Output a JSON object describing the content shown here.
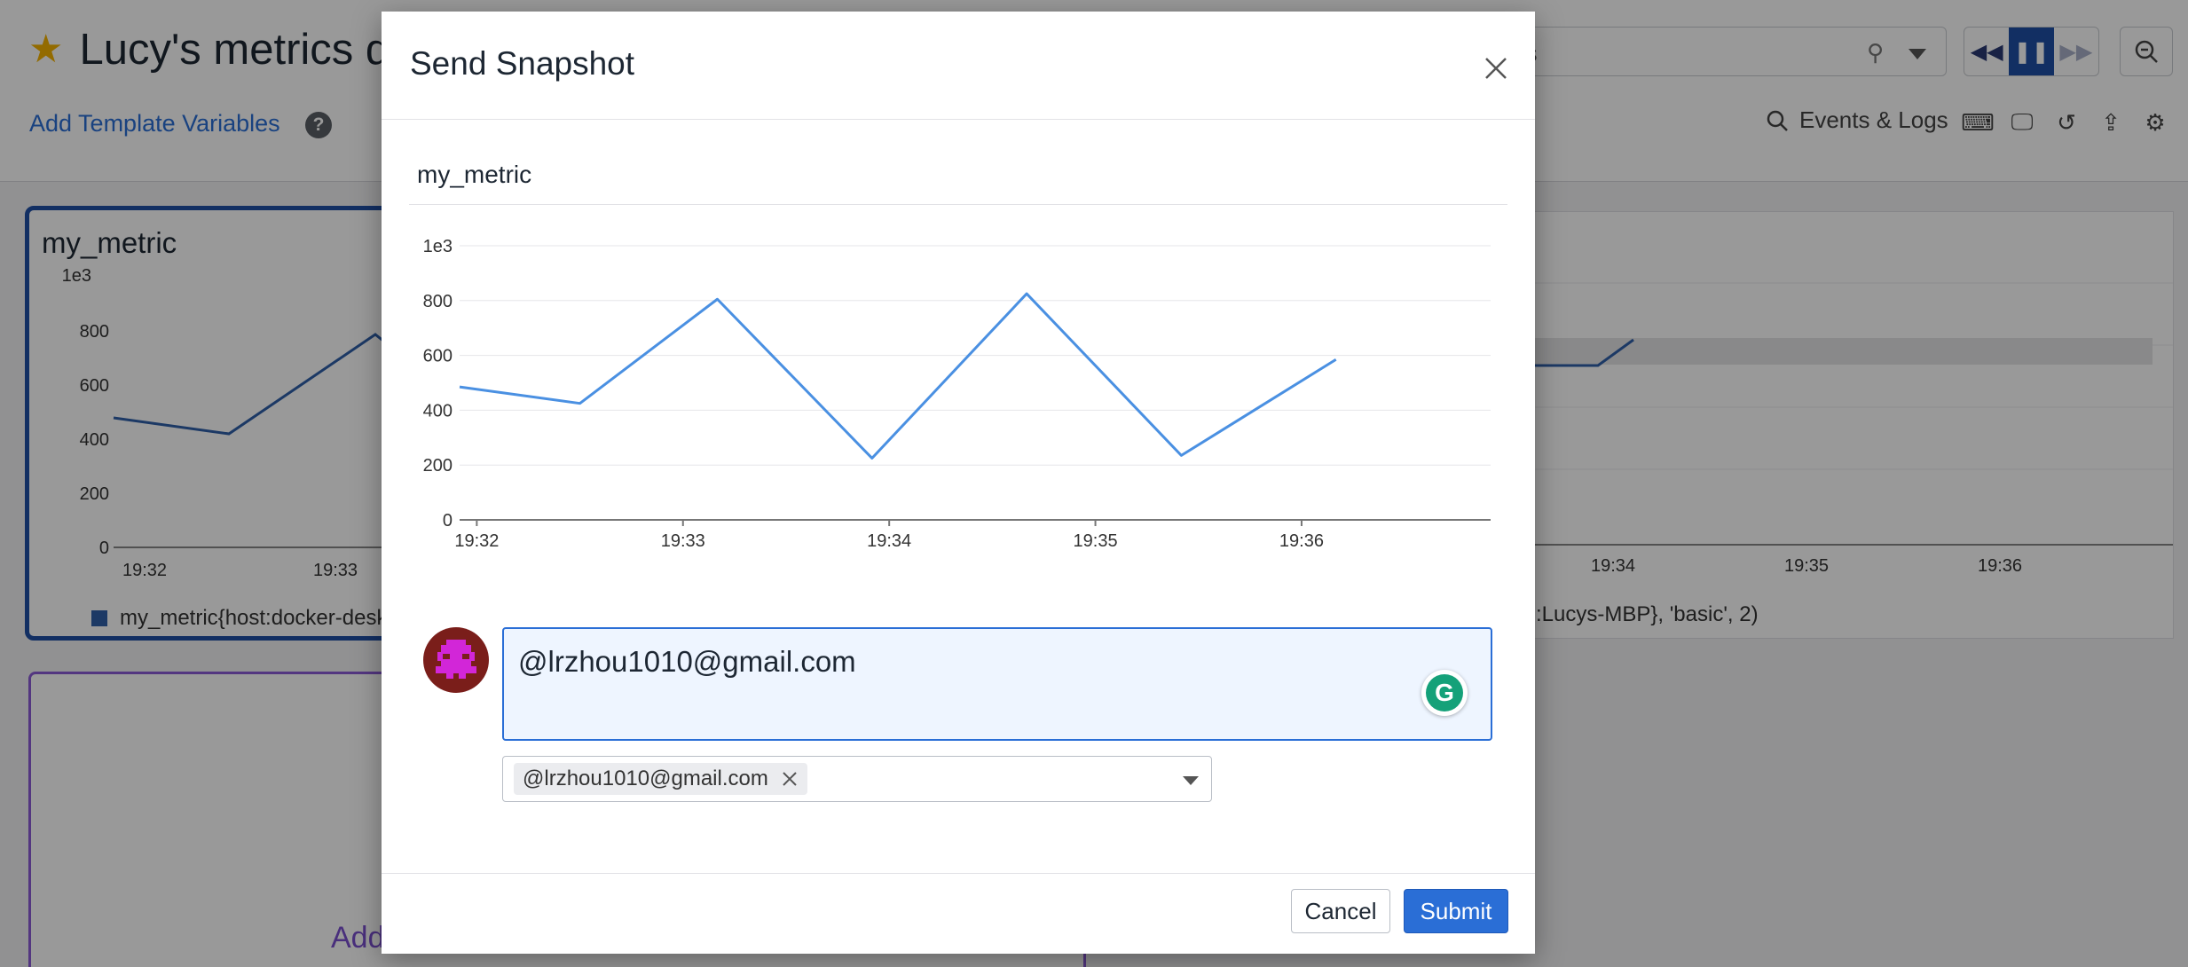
{
  "dashboard": {
    "title": "Lucy's metrics da",
    "add_template_variables": "Add Template Variables",
    "help_glyph": "?",
    "search_visible_text": "s",
    "events_logs": "Events & Logs",
    "left_widget": {
      "title": "my_metric",
      "y_unit": "1e3",
      "y_ticks": [
        "800",
        "600",
        "400",
        "200",
        "0"
      ],
      "x_ticks": [
        "19:32",
        "19:33"
      ],
      "legend": "my_metric{host:docker-desk"
    },
    "right_widget": {
      "x_ticks": [
        "19:34",
        "19:35",
        "19:36"
      ],
      "legend": ":Lucys-MBP}, 'basic', 2)"
    },
    "purple_widget_text": "Add"
  },
  "modal": {
    "title": "Send Snapshot",
    "metric_name": "my_metric",
    "comment_text": "@lrzhou1010@gmail.com",
    "recipient_tag": "@lrzhou1010@gmail.com",
    "cancel_label": "Cancel",
    "submit_label": "Submit"
  },
  "colors": {
    "line": "#4a90e2",
    "primary": "#2a6ed6",
    "active_button": "#1f4fa6",
    "accent_star": "#f5b301"
  },
  "chart_data": {
    "type": "line",
    "title": "my_metric",
    "y_unit_label": "1e3",
    "x_ticks": [
      "19:32",
      "19:33",
      "19:34",
      "19:35",
      "19:36"
    ],
    "y_ticks": [
      "0",
      "200",
      "400",
      "600",
      "800"
    ],
    "ylim": [
      0,
      1000
    ],
    "xlim": [
      "19:31:55",
      "19:36:55"
    ],
    "grid": true,
    "series": [
      {
        "x": [
          "19:31:55",
          "19:32:30",
          "19:33:10",
          "19:33:55",
          "19:34:40",
          "19:35:25",
          "19:36:10"
        ],
        "values": [
          485,
          425,
          805,
          225,
          825,
          235,
          585
        ]
      }
    ]
  }
}
